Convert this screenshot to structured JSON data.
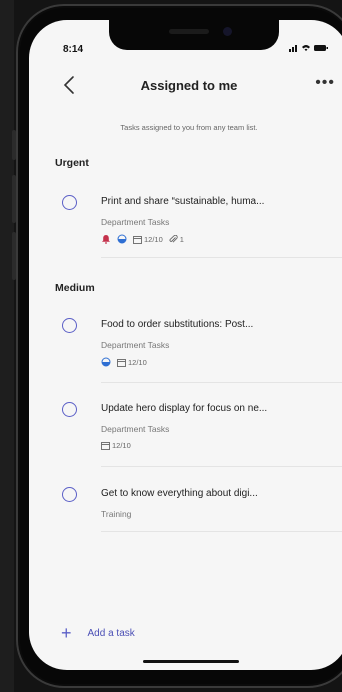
{
  "status_bar": {
    "time": "8:14"
  },
  "header": {
    "title": "Assigned to me",
    "subtitle": "Tasks assigned to you from any team list."
  },
  "sections": [
    {
      "title": "Urgent"
    },
    {
      "title": "Medium"
    }
  ],
  "tasks": [
    {
      "name": "Print and share “sustainable, huma...",
      "list": "Department Tasks",
      "date": "12/10",
      "attachments": "1"
    },
    {
      "name": "Food to order substitutions: Post...",
      "list": "Department Tasks",
      "date": "12/10"
    },
    {
      "name": "Update hero display for focus on ne...",
      "list": "Department Tasks",
      "date": "12/10"
    },
    {
      "name": "Get to know everything about digi...",
      "list": "Training"
    }
  ],
  "footer": {
    "add_label": "Add a task"
  },
  "colors": {
    "accent": "#5b5fc7",
    "urgent": "#c4314b",
    "progress": "#2f6fd3"
  },
  "icons": [
    "back-chevron-icon",
    "more-options-icon",
    "urgent-bell-icon",
    "half-progress-icon",
    "calendar-icon",
    "paperclip-icon",
    "plus-icon"
  ]
}
